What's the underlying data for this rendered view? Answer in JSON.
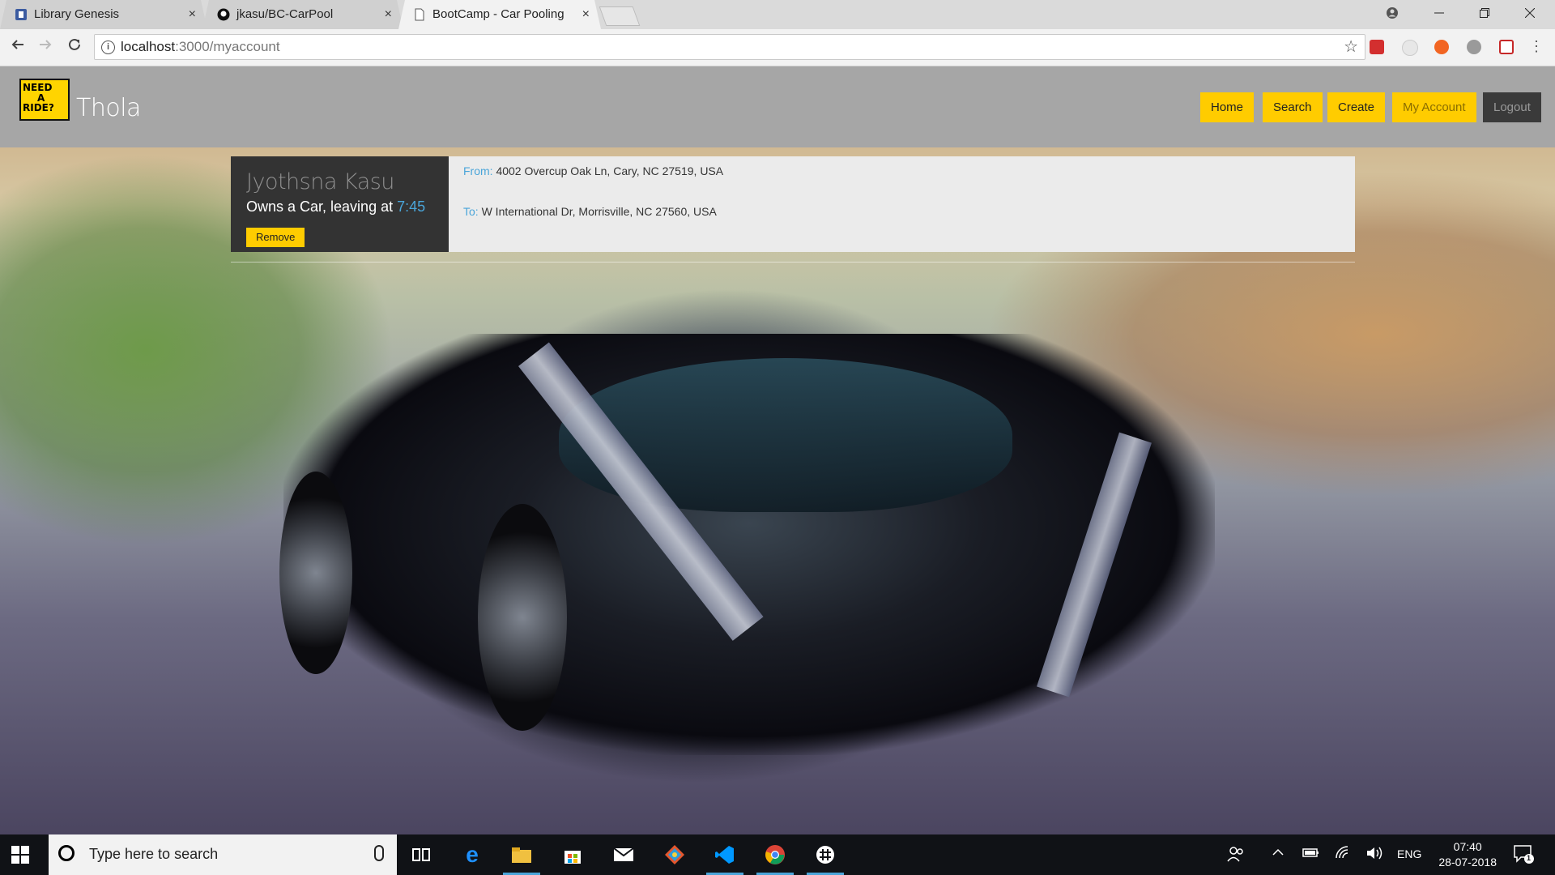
{
  "browser": {
    "tabs": [
      {
        "title": "Library Genesis",
        "active": false
      },
      {
        "title": "jkasu/BC-CarPool",
        "active": false
      },
      {
        "title": "BootCamp - Car Pooling",
        "active": true
      }
    ],
    "url_host": "localhost",
    "url_path": ":3000/myaccount",
    "close_glyph": "×"
  },
  "site": {
    "logo_lines": [
      "NEED",
      "A",
      "RIDE?"
    ],
    "brand": "Thola",
    "nav": {
      "home": "Home",
      "search": "Search",
      "create": "Create",
      "account": "My Account",
      "logout": "Logout"
    }
  },
  "ride": {
    "name": "Jyothsna Kasu",
    "owns_text": "Owns a Car, leaving at ",
    "time": "7:45",
    "remove_label": "Remove",
    "from_label": "From:",
    "from_value": " 4002 Overcup Oak Ln, Cary, NC 27519, USA",
    "to_label": "To:",
    "to_value": " W International Dr, Morrisville, NC 27560, USA"
  },
  "taskbar": {
    "search_placeholder": "Type here to search",
    "language": "ENG",
    "time": "07:40",
    "date": "28-07-2018",
    "notification_count": "1"
  },
  "colors": {
    "accent_yellow": "#ffcc00",
    "link_blue": "#4aa5d9",
    "header_gray": "#a6a6a6",
    "card_dark": "#333333"
  }
}
